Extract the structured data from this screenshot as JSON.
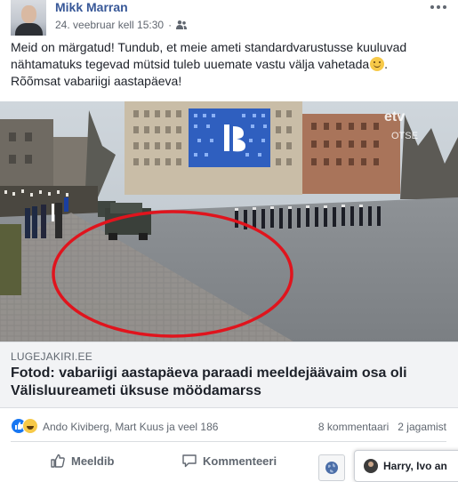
{
  "post": {
    "author": "Mikk Marran",
    "timestamp": "24. veebruar kell 15:30",
    "separator": "·",
    "audience_icon": "friends-icon",
    "text_line1": "Meid on märgatud! Tundub, et meie ameti standardvarustusse kuuluvad",
    "text_line2": "nähtamatuks tegevad mütsid tuleb uuemate vastu välja vahetada",
    "text_line3": "Rõõmsat vabariigi aastapäeva!"
  },
  "photo": {
    "watermark_primary": "etv",
    "watermark_secondary": "OTSE"
  },
  "link": {
    "domain": "LUGEJAKIRI.EE",
    "title": "Fotod: vabariigi aastapäeva paraadi meeldejäävaim osa oli Välisluureameti üksuse möödamarss"
  },
  "reactions": {
    "names": "Ando Kiviberg, Mart Kuus ja veel 186",
    "comments": "8 kommentaari",
    "shares": "2 jagamist"
  },
  "actions": {
    "like": "Meeldib",
    "comment": "Kommenteeri"
  },
  "chat": {
    "label": "Harry, Ivo an"
  },
  "colors": {
    "author_link": "#385898",
    "secondary_text": "#606770",
    "highlight_circle": "#e0141d",
    "like_blue": "#1877f2"
  }
}
